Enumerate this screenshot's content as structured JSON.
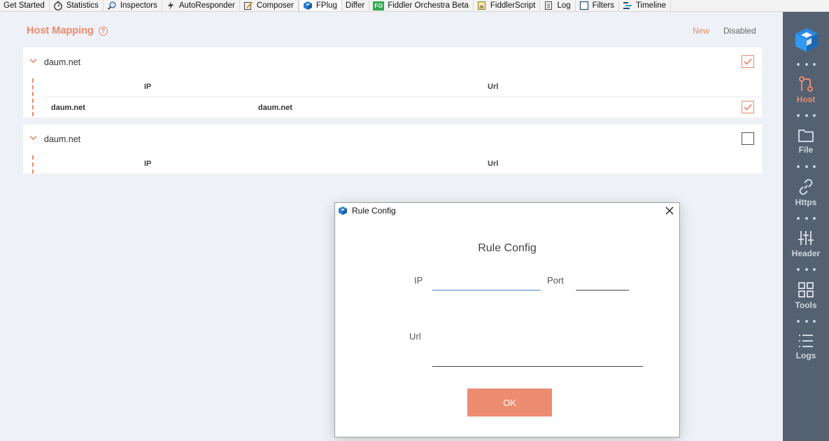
{
  "tabs": [
    {
      "name": "tab-get-started",
      "label": "Get Started",
      "icon": "none"
    },
    {
      "name": "tab-statistics",
      "label": "Statistics",
      "icon": "stopwatch-icon"
    },
    {
      "name": "tab-inspectors",
      "label": "Inspectors",
      "icon": "magnifier-icon"
    },
    {
      "name": "tab-autoresponder",
      "label": "AutoResponder",
      "icon": "lightning-icon"
    },
    {
      "name": "tab-composer",
      "label": "Composer",
      "icon": "pencil-icon"
    },
    {
      "name": "tab-fplug",
      "label": "FPlug",
      "icon": "cube-icon"
    },
    {
      "name": "tab-differ",
      "label": "Differ",
      "icon": "none"
    },
    {
      "name": "tab-fiddler-orchestra",
      "label": "Fiddler Orchestra Beta",
      "icon": "fo-icon",
      "badge": "FO"
    },
    {
      "name": "tab-fiddlerscript",
      "label": "FiddlerScript",
      "icon": "js-icon"
    },
    {
      "name": "tab-log",
      "label": "Log",
      "icon": "document-icon"
    },
    {
      "name": "tab-filters",
      "label": "Filters",
      "icon": "checkbox-icon"
    },
    {
      "name": "tab-timeline",
      "label": "Timeline",
      "icon": "timeline-icon"
    }
  ],
  "active_tab": "FPlug",
  "header": {
    "title": "Host Mapping",
    "help_icon": "?",
    "filter_new": "New",
    "filter_disabled": "Disabled"
  },
  "rules": [
    {
      "host": "daum.net",
      "enabled": true,
      "columns": {
        "ip": "IP",
        "url": "Url"
      },
      "rows": [
        {
          "ip": "daum.net",
          "url": "daum.net",
          "enabled": true
        }
      ]
    },
    {
      "host": "daum.net",
      "enabled": false,
      "columns": {
        "ip": "IP",
        "url": "Url"
      },
      "rows": []
    }
  ],
  "sidebar": {
    "items": [
      {
        "label": "Host",
        "icon": "branch-icon",
        "active": true
      },
      {
        "label": "File",
        "icon": "folder-icon",
        "active": false
      },
      {
        "label": "Https",
        "icon": "link-icon",
        "active": false
      },
      {
        "label": "Header",
        "icon": "sliders-icon",
        "active": false
      },
      {
        "label": "Tools",
        "icon": "grid-icon",
        "active": false
      },
      {
        "label": "Logs",
        "icon": "list-icon",
        "active": false
      }
    ]
  },
  "dialog": {
    "window_title": "Rule Config",
    "heading": "Rule Config",
    "ip_label": "IP",
    "ip_value": "",
    "port_label": "Port",
    "port_value": "",
    "url_label": "Url",
    "url_value": "",
    "ok_label": "OK"
  },
  "colors": {
    "accent": "#ea8a6c",
    "sidebar_bg": "#536171",
    "page_bg": "#eef1f5"
  }
}
